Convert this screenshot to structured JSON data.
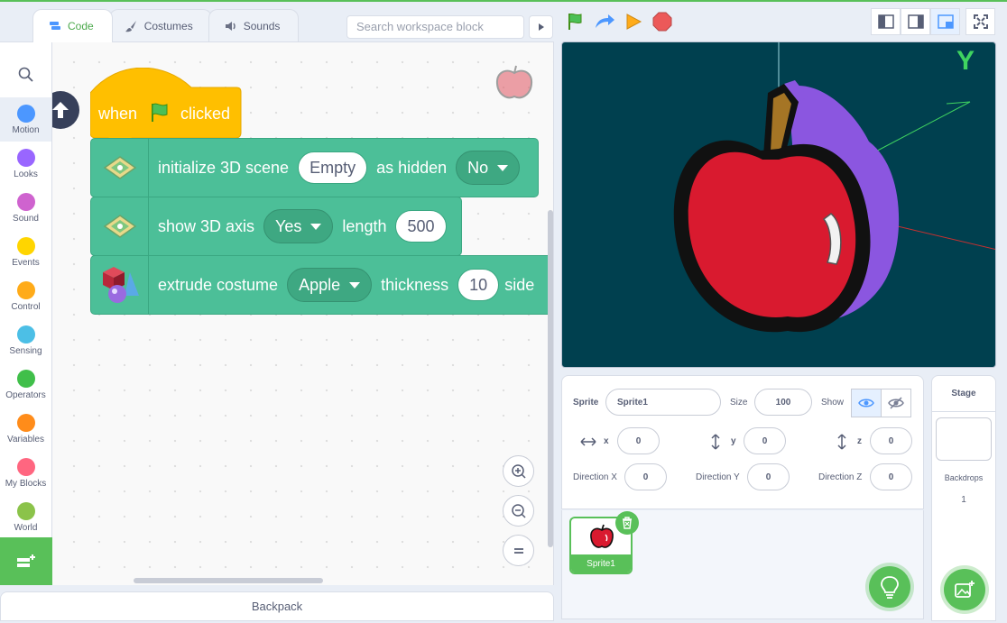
{
  "tabs": [
    {
      "label": "Code",
      "active": true,
      "icon": "code-icon"
    },
    {
      "label": "Costumes",
      "active": false,
      "icon": "brush-icon"
    },
    {
      "label": "Sounds",
      "active": false,
      "icon": "speaker-icon"
    }
  ],
  "search": {
    "placeholder": "Search workspace block"
  },
  "categories": [
    {
      "label": "Motion",
      "color": "#4c97ff",
      "active": true
    },
    {
      "label": "Looks",
      "color": "#9966ff"
    },
    {
      "label": "Sound",
      "color": "#cf63cf"
    },
    {
      "label": "Events",
      "color": "#ffd500"
    },
    {
      "label": "Control",
      "color": "#ffab19"
    },
    {
      "label": "Sensing",
      "color": "#4cbfe6"
    },
    {
      "label": "Operators",
      "color": "#40bf4a"
    },
    {
      "label": "Variables",
      "color": "#ff8c1a"
    },
    {
      "label": "My Blocks",
      "color": "#ff6680"
    },
    {
      "label": "World",
      "color": "#8bc34a"
    }
  ],
  "script": {
    "hat": {
      "before": "when",
      "after": "clicked",
      "color": "#ffbf00"
    },
    "init": {
      "text": "initialize 3D scene",
      "scene_value": "Empty",
      "hidden_label": "as hidden",
      "hidden_value": "No"
    },
    "axis": {
      "text": "show 3D axis",
      "value": "Yes",
      "length_label": "length",
      "length_value": "500"
    },
    "extrude": {
      "text": "extrude costume",
      "costume_value": "Apple",
      "thickness_label": "thickness",
      "thickness_value": "10",
      "trailing": "side"
    },
    "block_color": "#4cbf98"
  },
  "stage": {
    "axis_label": "Y",
    "background": "#00404f"
  },
  "sprite_info": {
    "sprite_label": "Sprite",
    "sprite_name": "Sprite1",
    "size_label": "Size",
    "size_value": "100",
    "show_label": "Show",
    "x_label": "x",
    "x_value": "0",
    "y_label": "y",
    "y_value": "0",
    "z_label": "z",
    "z_value": "0",
    "dir_x_label": "Direction X",
    "dir_x_value": "0",
    "dir_y_label": "Direction Y",
    "dir_y_value": "0",
    "dir_z_label": "Direction Z",
    "dir_z_value": "0"
  },
  "sprites": [
    {
      "name": "Sprite1",
      "selected": true
    }
  ],
  "stage_selector": {
    "title": "Stage",
    "backdrops_label": "Backdrops",
    "backdrops_count": "1"
  },
  "backpack": {
    "label": "Backpack"
  }
}
